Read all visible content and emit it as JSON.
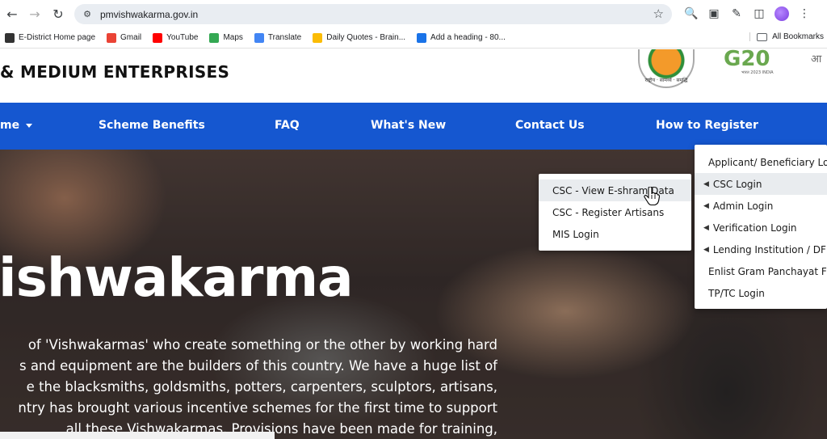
{
  "browser": {
    "url": "pmvishwakarma.gov.in",
    "bookmarks": [
      {
        "label": "E-District Home page",
        "icon": "globe-icon",
        "color": "#333333"
      },
      {
        "label": "Gmail",
        "icon": "gmail-icon",
        "color": "#ea4335"
      },
      {
        "label": "YouTube",
        "icon": "youtube-icon",
        "color": "#ff0000"
      },
      {
        "label": "Maps",
        "icon": "maps-icon",
        "color": "#34a853"
      },
      {
        "label": "Translate",
        "icon": "translate-icon",
        "color": "#4285f4"
      },
      {
        "label": "Daily Quotes - Brain...",
        "icon": "quotes-icon",
        "color": "#fbbc05"
      },
      {
        "label": "Add a heading - 80...",
        "icon": "canva-icon",
        "color": "#1a73e8"
      }
    ],
    "all_bookmarks": "All Bookmarks"
  },
  "header": {
    "title": "& MEDIUM ENTERPRISES",
    "logo_text": "राष्ट्रीय · सामर्थ्य · समृद्धि",
    "g20": "G20",
    "g20_sub": "भारत 2023 INDIA",
    "hindi_fragment": "आ"
  },
  "nav": {
    "items": [
      "me",
      "Scheme Benefits",
      "FAQ",
      "What's New",
      "Contact Us",
      "How to Register"
    ]
  },
  "hero": {
    "title": "ishwakarma",
    "lines": [
      "of 'Vishwakarmas' who create something or the other by working hard",
      "s and equipment are the builders of this country. We have a huge list of",
      "e the blacksmiths, goldsmiths, potters, carpenters, sculptors, artisans,",
      "ntry has brought various incentive schemes for the first time to support",
      "all these Vishwakarmas. Provisions have been made for training,"
    ]
  },
  "menu_csc": {
    "items": [
      "CSC - View E-shram Data",
      "CSC - Register Artisans",
      "MIS Login"
    ]
  },
  "menu_login": {
    "items": [
      {
        "label": "Applicant/ Beneficiary Lo",
        "bullet": false
      },
      {
        "label": "CSC Login",
        "bullet": true
      },
      {
        "label": "Admin Login",
        "bullet": true
      },
      {
        "label": "Verification Login",
        "bullet": true
      },
      {
        "label": "Lending Institution / DF",
        "bullet": true
      },
      {
        "label": "Enlist Gram Panchayat F",
        "bullet": false
      },
      {
        "label": "TP/TC Login",
        "bullet": false
      }
    ]
  },
  "colors": {
    "nav_blue": "#1557d0"
  }
}
